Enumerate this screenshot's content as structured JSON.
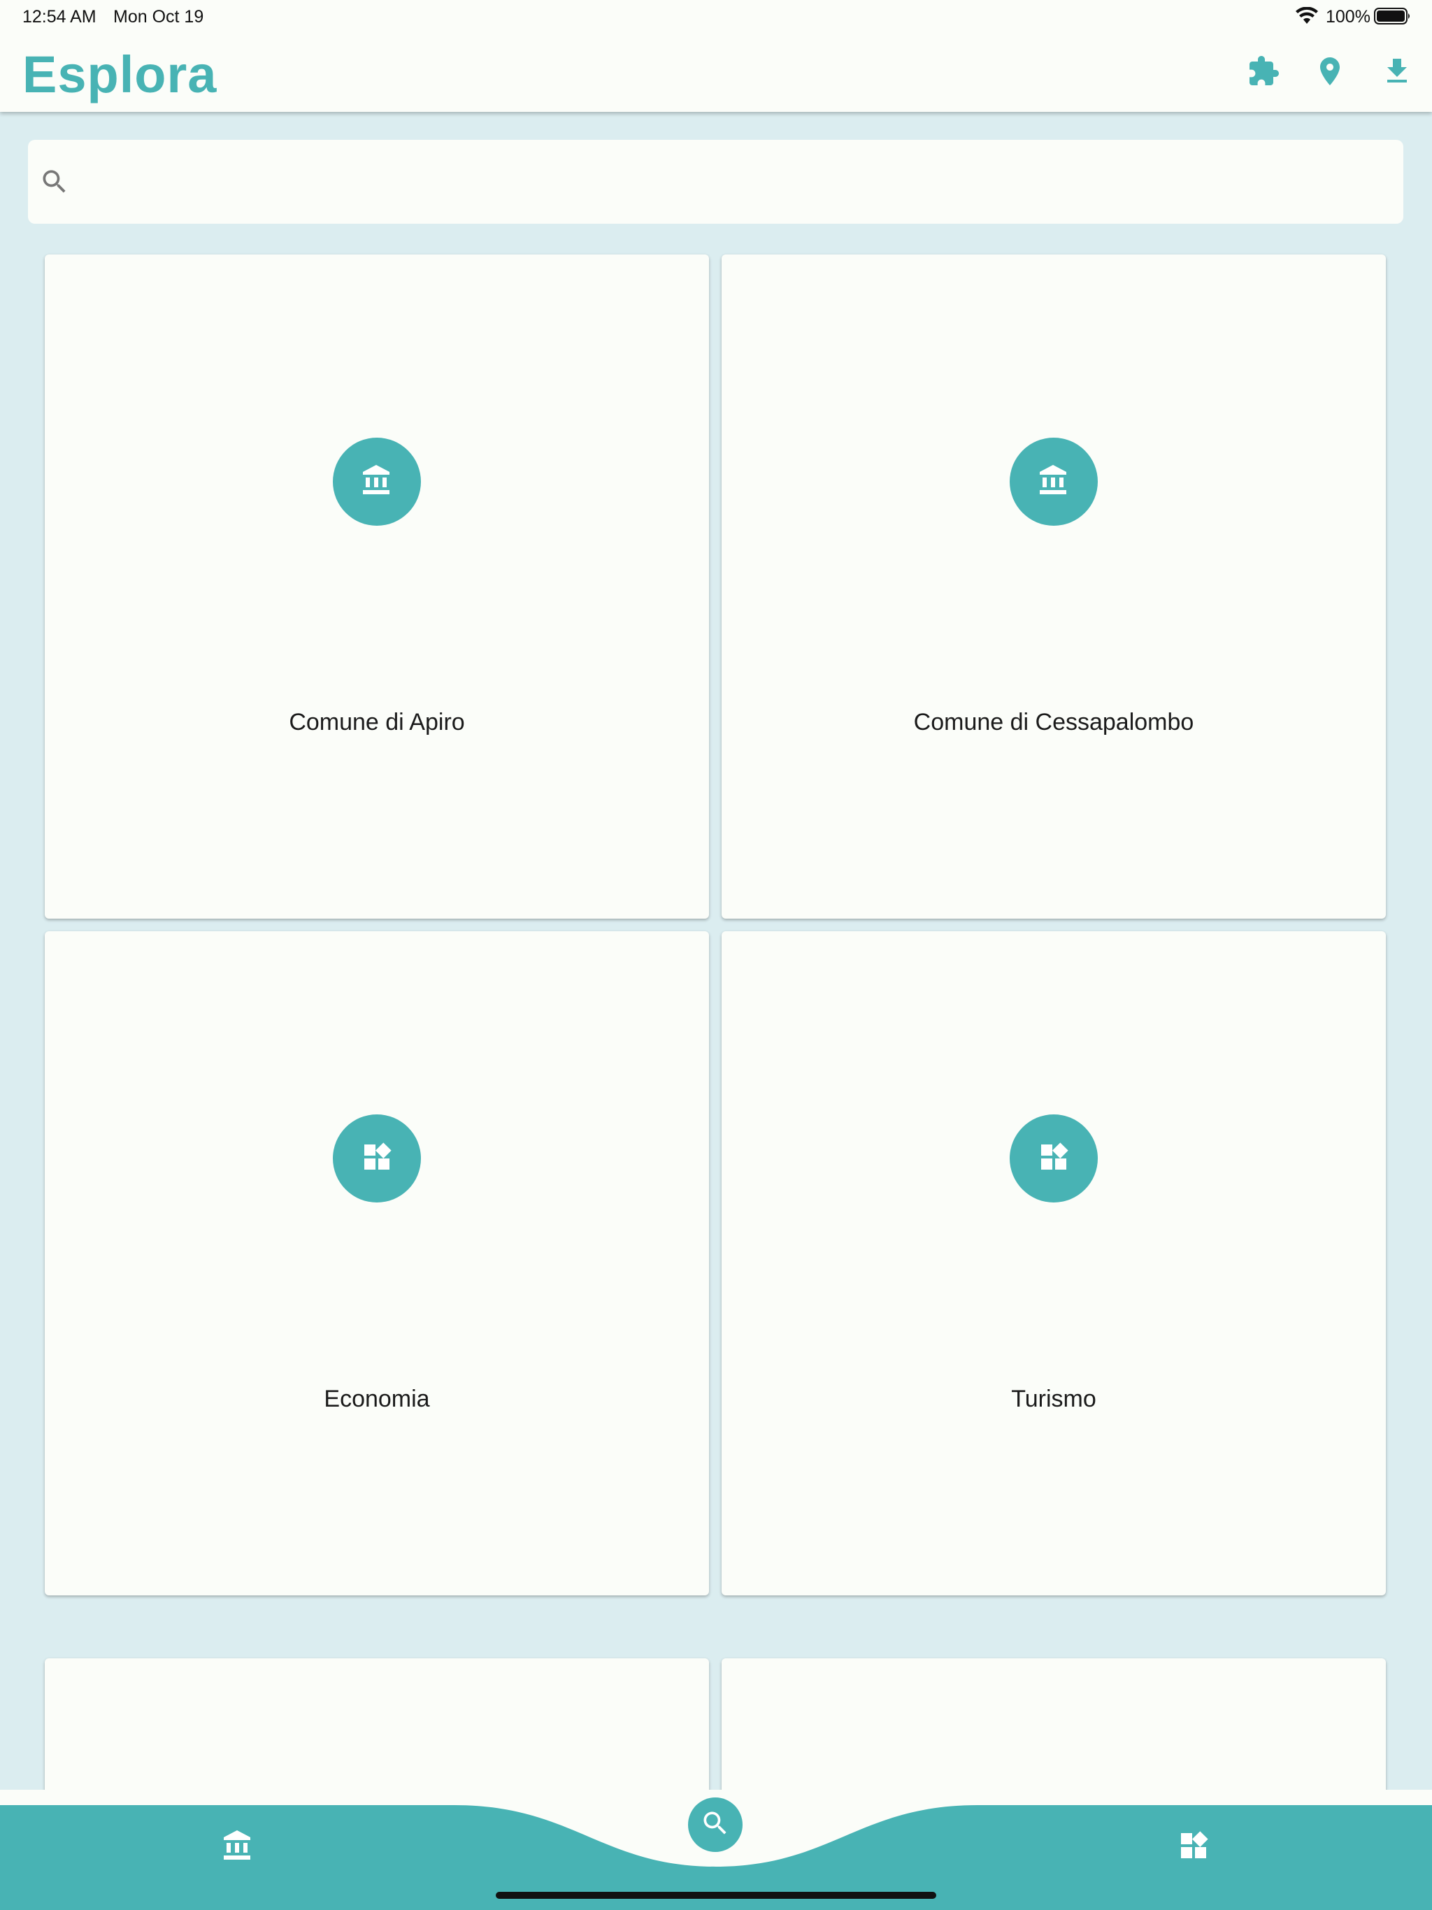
{
  "status_bar": {
    "time": "12:54 AM",
    "date": "Mon Oct 19",
    "battery": "100%"
  },
  "app_bar": {
    "title": "Esplora",
    "actions": [
      "extension-icon",
      "location-pin-icon",
      "download-icon"
    ]
  },
  "search": {
    "placeholder": "",
    "value": ""
  },
  "cards": [
    {
      "label": "Comune di Apiro",
      "icon": "institution-icon"
    },
    {
      "label": "Comune di Cessapalombo",
      "icon": "institution-icon"
    },
    {
      "label": "Economia",
      "icon": "category-icon"
    },
    {
      "label": "Turismo",
      "icon": "category-icon"
    }
  ],
  "bottom_nav": {
    "items": [
      "institution-icon",
      "search-icon",
      "category-icon"
    ],
    "selected": "search-icon"
  },
  "colors": {
    "accent": "#48b3b4",
    "background": "#dbedf0",
    "surface": "#fbfdf9",
    "text": "#1b1b1b"
  }
}
